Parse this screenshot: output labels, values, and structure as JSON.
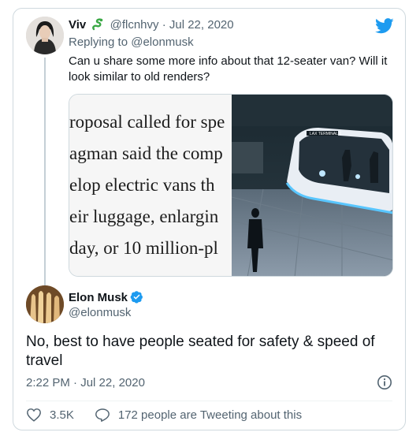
{
  "reply": {
    "display_name": "Viv",
    "handle": "@flcnhvy",
    "separator": "·",
    "date": "Jul 22, 2020",
    "replying_prefix": "Replying to",
    "replying_to": "@elonmusk",
    "text": "Can u share some more info about that 12-seater van? Will it look similar to old renders?",
    "media": {
      "article_lines": [
        "roposal called for spe",
        "agman said the comp",
        "elop electric vans th",
        "eir luggage, enlargin",
        "day, or 10 million-pl"
      ],
      "sign_text": "LAX TERMINAL 2"
    }
  },
  "main": {
    "display_name": "Elon Musk",
    "handle": "@elonmusk",
    "text": "No, best to have people seated for safety & speed of travel",
    "time": "2:22 PM",
    "separator": "·",
    "date": "Jul 22, 2020",
    "likes": "3.5K",
    "conversation": "172 people are Tweeting about this"
  },
  "icons": {
    "brand": "twitter-bird-icon",
    "like": "heart-icon",
    "reply": "speech-bubble-icon",
    "info": "info-icon",
    "verified": "verified-badge-icon",
    "emoji": "snake-emoji-icon"
  },
  "colors": {
    "twitter_blue": "#1d9bf0",
    "text": "#0f1419",
    "muted": "#536471",
    "border": "#cfd9de"
  }
}
